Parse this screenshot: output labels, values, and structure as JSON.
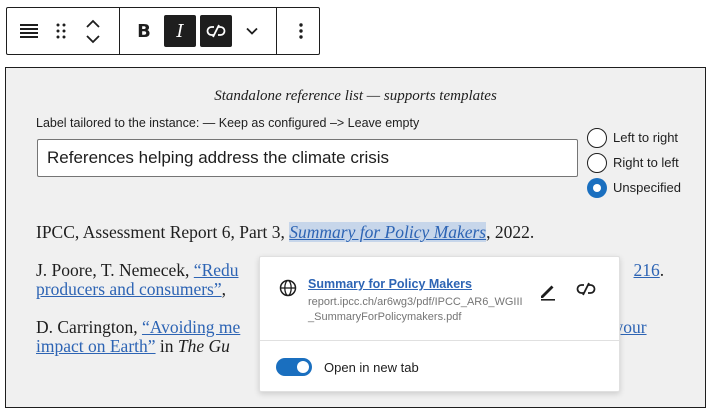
{
  "toolbar": {
    "icons": [
      "align-icon",
      "drag-handle-icon",
      "move-up-icon",
      "move-down-icon",
      "bold-icon",
      "italic-icon",
      "unlink-icon",
      "chevron-down-icon",
      "more-options-icon"
    ],
    "bold_label": "B",
    "italic_label": "I"
  },
  "block": {
    "caption": "Standalone reference list — supports templates",
    "label_line": "Label tailored to the instance: — Keep as configured –> Leave empty",
    "title_value": "References helping address the climate crisis",
    "radio_options": [
      {
        "label": "Left to right",
        "checked": false
      },
      {
        "label": "Right to left",
        "checked": false
      },
      {
        "label": "Unspecified",
        "checked": true
      }
    ]
  },
  "references": {
    "r1": {
      "prefix": "IPCC, Assessment Report 6, Part 3, ",
      "link": "Summary for Policy Makers",
      "suffix": ", 2022."
    },
    "r2": {
      "prefix": "J. Poore, T. Nemecek, ",
      "link_start": "“Redu",
      "link_line2": "producers and consumers”",
      "punct": ", ",
      "tail": "216",
      "end": "."
    },
    "r3": {
      "prefix": "D. Carrington, ",
      "link_start": "“Avoiding me",
      "link_tail": "e your",
      "link_line2": "impact on Earth”",
      "mid": " in ",
      "source": "The Gu"
    }
  },
  "popover": {
    "title": "Summary for Policy Makers",
    "url": "report.ipcc.ch/ar6wg3/pdf/IPCC_AR6_WGIII_SummaryForPolicymakers.pdf",
    "toggle_label": "Open in new tab",
    "toggle_on": true
  },
  "colors": {
    "accent": "#1a6fbf",
    "link": "#2d64b4",
    "highlight": "#c7d6ea",
    "block_bg": "#f0f0f0"
  }
}
